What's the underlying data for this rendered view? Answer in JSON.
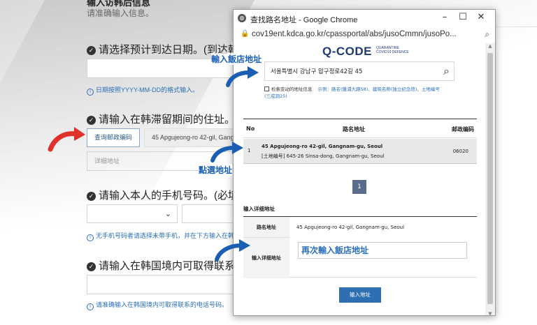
{
  "background_form": {
    "heading": "输入访韩后信息",
    "subtext": "请准确输入信息。",
    "q_arrival": "请选择预计到达日期。(到达韩",
    "hint_date": "日期按照YYYY-MM-DD的格式输入。",
    "q_address": "请输入在韩滞留期间的住址。(必",
    "postcode_button": "查询邮政编码",
    "address_prefilled": "45 Apgujeong-ro 42-gil, Gangn",
    "detail_placeholder": "详细地址",
    "q_phone": "请输入本人的手机号码。(必填)",
    "hint_phone": "无手机号码者请选择未带手机，并在下方输入在韩",
    "q_contact": "请输入在韩国境内可取得联系的",
    "hint_contact": "请准确输入在韩国境内可取得联系的电话号码。"
  },
  "popup": {
    "window_title": "查找路名地址 - Google Chrome",
    "url": "cov19ent.kdca.go.kr/cpassportal/abs/jusoCmmn/jusoPo...",
    "logo": "Q-CODE",
    "logo_sub_1": "QUARANTINE",
    "logo_sub_2": "COVID19 DEFENCE",
    "search_value": "서울특별시 강남구 압구정로42길 45",
    "search_option": "检索变动的地址信息",
    "search_example": "示例：路名(盤浦大路58)、建筑名称(独立纪念馆)、土地编号",
    "search_example_2": "(三成洞25)",
    "table_headers": {
      "no": "No",
      "road": "路名地址",
      "zip": "邮政编码"
    },
    "result": {
      "no": "1",
      "road_address": "45 Apgujeong-ro 42-gil, Gangnam-gu, Seoul",
      "land_address": "[土地编号] 645-26 Sinsa-dong, Gangnam-gu, Seoul",
      "zip": "06020"
    },
    "page": "1",
    "detail_section_title": "输入详细地址",
    "detail_road_label": "路名地址",
    "detail_road_value": "45 Apgujeong-ro 42-gil, Gangnam-gu, Seoul",
    "detail_input_label": "输入详细地址",
    "detail_input_value": "再次輸入飯店地址",
    "submit_label": "输入地址"
  },
  "annotations": {
    "enter_hotel": "輸入飯店地址",
    "click_address": "點選地址"
  },
  "colors": {
    "annotation_blue": "#1a5fb4",
    "arrow_red": "#e0312b",
    "qcode_navy": "#1f3a74"
  }
}
